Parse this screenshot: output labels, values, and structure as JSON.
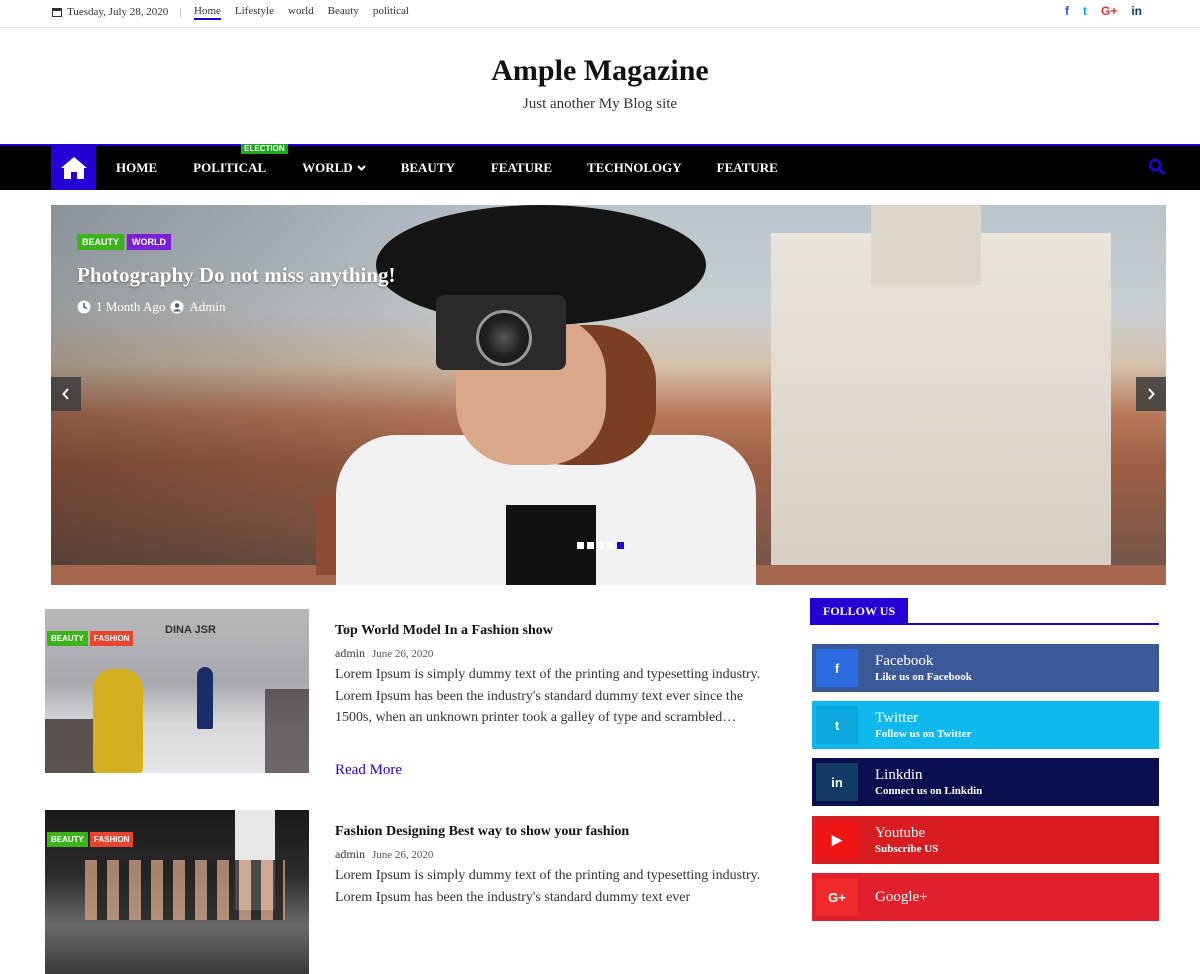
{
  "topbar": {
    "date": "Tuesday, July 28, 2020",
    "links": [
      "Home",
      "Lifestyle",
      "world",
      "Beauty",
      "political"
    ],
    "social": [
      "f",
      "t",
      "G+",
      "in"
    ]
  },
  "header": {
    "title": "Ample Magazine",
    "tagline": "Just another My Blog site"
  },
  "nav": {
    "items": [
      {
        "label": "HOME"
      },
      {
        "label": "POLITICAL",
        "badge": "ELECTION"
      },
      {
        "label": "WORLD"
      },
      {
        "label": "BEAUTY"
      },
      {
        "label": "FEATURE"
      },
      {
        "label": "TECHNOLOGY"
      },
      {
        "label": "FEATURE"
      }
    ]
  },
  "slider": {
    "categories": [
      {
        "label": "BEAUTY",
        "color": "#3cb31b"
      },
      {
        "label": "WORLD",
        "color": "#7b1fd6"
      }
    ],
    "title": "Photography Do not miss anything!",
    "time": "1 Month Ago",
    "author": "Admin",
    "slide_count": 5,
    "active_slide": 5
  },
  "posts": [
    {
      "categories": [
        {
          "label": "BEAUTY",
          "color": "#3cb31b"
        },
        {
          "label": "FASHION",
          "color": "#e8452c"
        }
      ],
      "title": "Top World Model In a Fashion show",
      "author": "admin",
      "date": "June 26, 2020",
      "excerpt": "Lorem Ipsum is simply dummy text of the printing and typesetting industry. Lorem Ipsum has been the industry's standard dummy text ever since the 1500s, when an unknown printer took a galley of type and scrambled…",
      "read_more": "Read More",
      "image_text": "DINA JSR"
    },
    {
      "categories": [
        {
          "label": "BEAUTY",
          "color": "#3cb31b"
        },
        {
          "label": "FASHION",
          "color": "#e8452c"
        }
      ],
      "title": "Fashion Designing Best way to show your fashion",
      "author": "admin",
      "date": "June 26, 2020",
      "excerpt": "Lorem Ipsum is simply dummy text of the printing and typesetting industry. Lorem Ipsum has been the industry's standard dummy text ever"
    }
  ],
  "sidebar": {
    "follow_title": "FOLLOW US",
    "networks": [
      {
        "name": "Facebook",
        "sub": "Like us on Facebook",
        "bg": "#3b5998",
        "icon_bg": "#2d6be0",
        "icon": "f"
      },
      {
        "name": "Twitter",
        "sub": "Follow us on Twitter",
        "bg": "#0fb9ed",
        "icon_bg": "#0aa8dc",
        "icon": "t"
      },
      {
        "name": "Linkdin",
        "sub": "Connect us on Linkdin",
        "bg": "#0a0f4f",
        "icon_bg": "#123a63",
        "icon": "in"
      },
      {
        "name": "Youtube",
        "sub": "Subscribe US",
        "bg": "#d81d22",
        "icon_bg": "#f01515",
        "icon": "▶"
      },
      {
        "name": "Google+",
        "sub": "",
        "bg": "#e0202e",
        "icon_bg": "#f02a2a",
        "icon": "G+"
      }
    ]
  },
  "colors": {
    "accent": "#2400d6"
  }
}
